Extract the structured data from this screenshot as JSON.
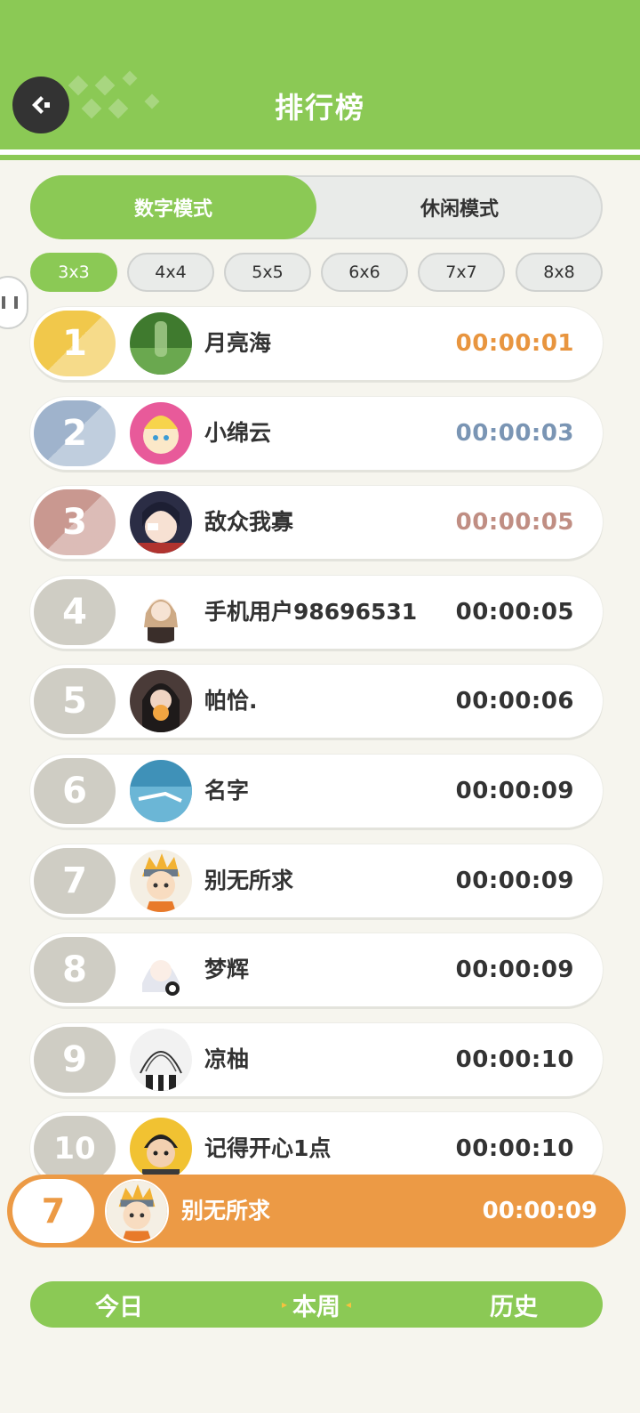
{
  "header": {
    "title": "排行榜"
  },
  "mode_switch": {
    "tabs": [
      {
        "label": "数字模式",
        "active": true
      },
      {
        "label": "休闲模式",
        "active": false
      }
    ]
  },
  "size_chips": [
    {
      "label": "3x3",
      "active": true
    },
    {
      "label": "4x4",
      "active": false
    },
    {
      "label": "5x5",
      "active": false
    },
    {
      "label": "6x6",
      "active": false
    },
    {
      "label": "7x7",
      "active": false
    },
    {
      "label": "8x8",
      "active": false
    }
  ],
  "rows": [
    {
      "rank": "1",
      "name": "月亮海",
      "time": "00:00:01",
      "badge_color": "#f1c84b",
      "time_color": "#e8953f",
      "avatar": "forest-avatar"
    },
    {
      "rank": "2",
      "name": "小绵云",
      "time": "00:00:03",
      "badge_color": "#9fb3cc",
      "time_color": "#7a95b4",
      "avatar": "cartoon-avatar"
    },
    {
      "rank": "3",
      "name": "敌众我寡",
      "time": "00:00:05",
      "badge_color": "#c99890",
      "time_color": "#c08e83",
      "avatar": "anime-girl-avatar"
    },
    {
      "rank": "4",
      "name": "手机用户98696531",
      "time": "00:00:05",
      "badge_color": "#cfcdc4",
      "time_color": "#333333",
      "avatar": "anime-maid-avatar"
    },
    {
      "rank": "5",
      "name": "帕恰.",
      "time": "00:00:06",
      "badge_color": "#cfcdc4",
      "time_color": "#333333",
      "avatar": "photo-avatar"
    },
    {
      "rank": "6",
      "name": "名字",
      "time": "00:00:09",
      "badge_color": "#cfcdc4",
      "time_color": "#333333",
      "avatar": "water-avatar"
    },
    {
      "rank": "7",
      "name": "别无所求",
      "time": "00:00:09",
      "badge_color": "#cfcdc4",
      "time_color": "#333333",
      "avatar": "ninja-avatar"
    },
    {
      "rank": "8",
      "name": "梦辉",
      "time": "00:00:09",
      "badge_color": "#cfcdc4",
      "time_color": "#333333",
      "avatar": "white-hair-avatar"
    },
    {
      "rank": "9",
      "name": "凉柚",
      "time": "00:00:10",
      "badge_color": "#cfcdc4",
      "time_color": "#333333",
      "avatar": "sketch-avatar"
    },
    {
      "rank": "10",
      "name": "记得开心1点",
      "time": "00:00:10",
      "badge_color": "#cfcdc4",
      "time_color": "#333333",
      "avatar": "boy-avatar"
    }
  ],
  "current_user": {
    "rank": "7",
    "name": "别无所求",
    "time": "00:00:09",
    "avatar": "ninja-avatar"
  },
  "period_tabs": [
    {
      "label": "今日",
      "active": false
    },
    {
      "label": "本周",
      "active": true
    },
    {
      "label": "历史",
      "active": false
    }
  ],
  "colors": {
    "primary_green": "#8bc955",
    "accent_orange": "#ec9a45",
    "background": "#f6f5ee"
  }
}
